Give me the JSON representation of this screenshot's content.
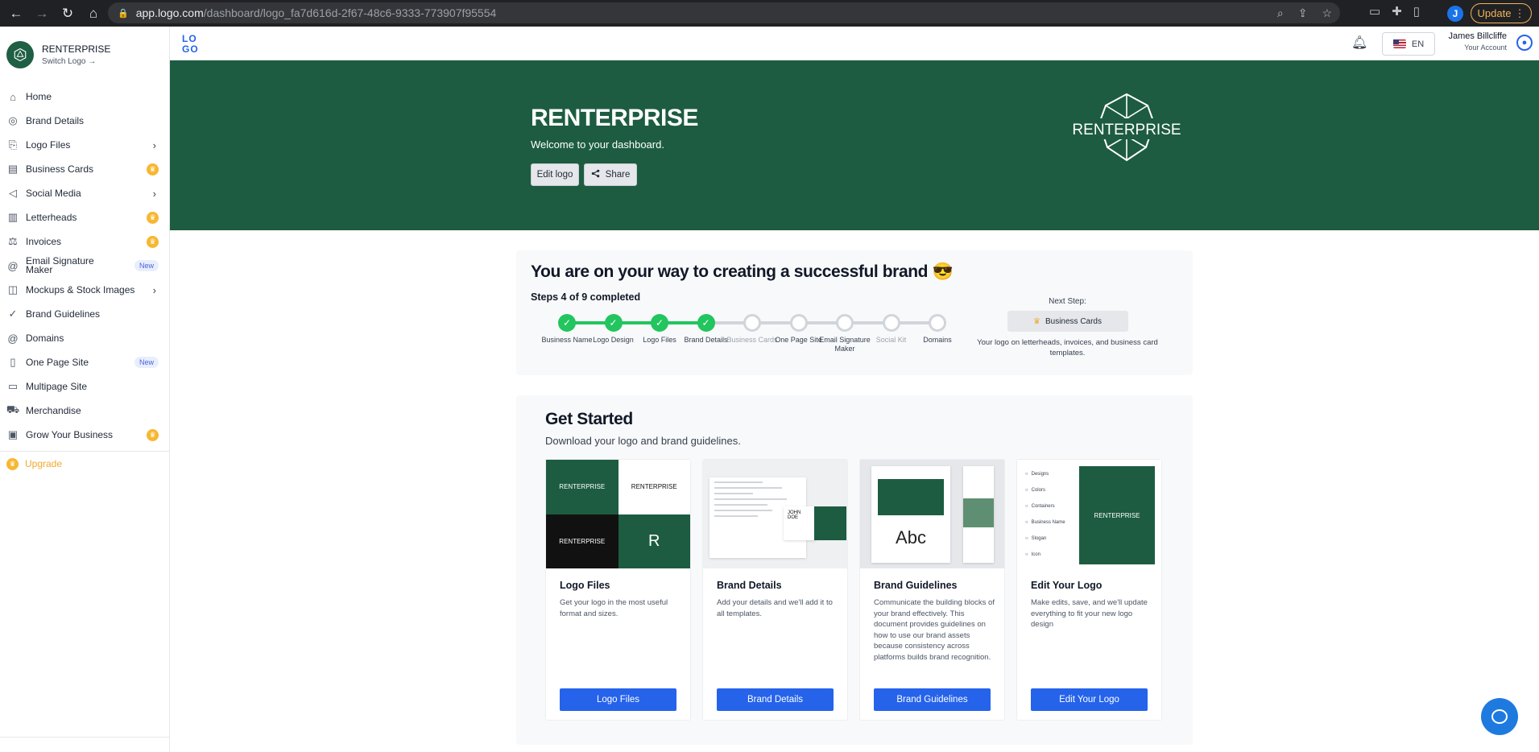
{
  "browser": {
    "url_host": "app.logo.com",
    "url_path": "/dashboard/logo_fa7d616d-2f67-48c6-9333-773907f95554",
    "profile_initial": "J",
    "update_label": "Update"
  },
  "sidebar": {
    "brand_name": "RENTERPRISE",
    "switch_label": "Switch Logo →",
    "items": [
      {
        "label": "Home",
        "icon": "home-icon"
      },
      {
        "label": "Brand Details",
        "icon": "user-circle-icon"
      },
      {
        "label": "Logo Files",
        "icon": "paperclip-icon",
        "chevron": true
      },
      {
        "label": "Business Cards",
        "icon": "id-card-icon",
        "crown": true
      },
      {
        "label": "Social Media",
        "icon": "megaphone-icon",
        "chevron": true
      },
      {
        "label": "Letterheads",
        "icon": "book-icon",
        "crown": true
      },
      {
        "label": "Invoices",
        "icon": "scale-icon",
        "crown": true
      },
      {
        "label": "Email Signature Maker",
        "icon": "at-icon",
        "badge": "New"
      },
      {
        "label": "Mockups & Stock Images",
        "icon": "stack-icon",
        "chevron": true
      },
      {
        "label": "Brand Guidelines",
        "icon": "check-circle-icon"
      },
      {
        "label": "Domains",
        "icon": "at-icon"
      },
      {
        "label": "One Page Site",
        "icon": "phone-icon",
        "badge": "New"
      },
      {
        "label": "Multipage Site",
        "icon": "monitor-icon"
      },
      {
        "label": "Merchandise",
        "icon": "cart-icon"
      },
      {
        "label": "Grow Your Business",
        "icon": "gift-icon",
        "crown": true
      }
    ],
    "upgrade_label": "Upgrade"
  },
  "appbar": {
    "logo_text": "LOGO",
    "lang_label": "EN",
    "user_name": "James Billcliffe",
    "user_account": "Your Account"
  },
  "hero": {
    "title": "RENTERPRISE",
    "subtitle": "Welcome to your dashboard.",
    "edit_label": "Edit logo",
    "share_label": "Share",
    "logo_text": "RENTERPRISE"
  },
  "progress": {
    "title": "You are on your way to creating a successful brand 😎",
    "steps_completed": "Steps 4 of 9 completed",
    "completed_count": 4,
    "steps": [
      {
        "label": "Business Name",
        "done": true
      },
      {
        "label": "Logo Design",
        "done": true
      },
      {
        "label": "Logo Files",
        "done": true
      },
      {
        "label": "Brand Details",
        "done": true
      },
      {
        "label": "Business Cards",
        "done": false,
        "muted": true
      },
      {
        "label": "One Page Site",
        "done": false
      },
      {
        "label": "Email Signature Maker",
        "done": false
      },
      {
        "label": "Social Kit",
        "done": false,
        "muted": true
      },
      {
        "label": "Domains",
        "done": false
      }
    ],
    "next_label": "Next Step:",
    "next_item": "Business Cards",
    "next_desc": "Your logo on letterheads, invoices, and business card templates."
  },
  "get_started": {
    "title": "Get Started",
    "subtitle": "Download your logo and brand guidelines.",
    "tiles": [
      {
        "title": "Logo Files",
        "desc": "Get your logo in the most useful format and sizes.",
        "button": "Logo Files"
      },
      {
        "title": "Brand Details",
        "desc": "Add your details and we'll add it to all templates.",
        "button": "Brand Details"
      },
      {
        "title": "Brand Guidelines",
        "desc": "Communicate the building blocks of your brand effectively. This document provides guidelines on how to use our brand assets because consistency across platforms builds brand recognition.",
        "button": "Brand Guidelines"
      },
      {
        "title": "Edit Your Logo",
        "desc": "Make edits, save, and we'll update everything to fit your new logo design",
        "button": "Edit Your Logo"
      }
    ],
    "thumb_texts": {
      "logo_small": "RENTERPRISE",
      "logo_mono": "R",
      "business_card_name": "JOHN DOE",
      "abc": "Abc",
      "editor_menu": [
        "Designs",
        "Colors",
        "Containers",
        "Business Name",
        "Slogan",
        "Icon"
      ]
    }
  },
  "colors": {
    "brand_green": "#1d5c41",
    "accent_blue": "#2563eb",
    "step_green": "#22c55e",
    "crown_gold": "#f7b731"
  }
}
